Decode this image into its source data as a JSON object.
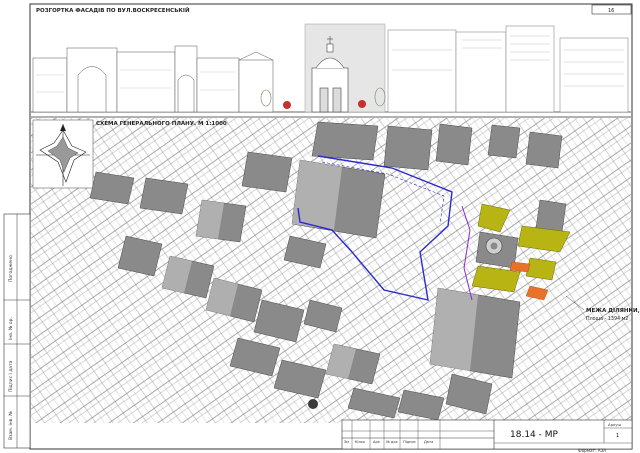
{
  "facade": {
    "title": "РОЗГОРТКА ФАСАДІВ ПО ВУЛ.ВОСКРЕСЕНСЬКІЙ",
    "sheet_number": "16"
  },
  "plan": {
    "title": "СХЕМА ГЕНЕРАЛЬНОГО ПЛАНУ. М 1:1000",
    "boundary_label": "МЕЖА ДІЛЯНКИ,",
    "boundary_area": "Площа - 1394 м2"
  },
  "side_stamp": {
    "cells": [
      "Погоджено",
      "Інв. № ор.",
      "Підпис і дата",
      "Взам. інв. №"
    ]
  },
  "title_block": {
    "sheet_label": "Аркуш",
    "sheet_value": "1",
    "code": "18.14 - МР",
    "format": "Формат: А3А",
    "columns": [
      "Зм",
      "Кільк",
      "Арк",
      "№ док",
      "Підпис",
      "Дата"
    ]
  },
  "colors": {
    "site_boundary": "#2a2ad0",
    "greenery": "#b8b414",
    "building_shade": "#8a8a8a",
    "paving": "#e8722a"
  }
}
